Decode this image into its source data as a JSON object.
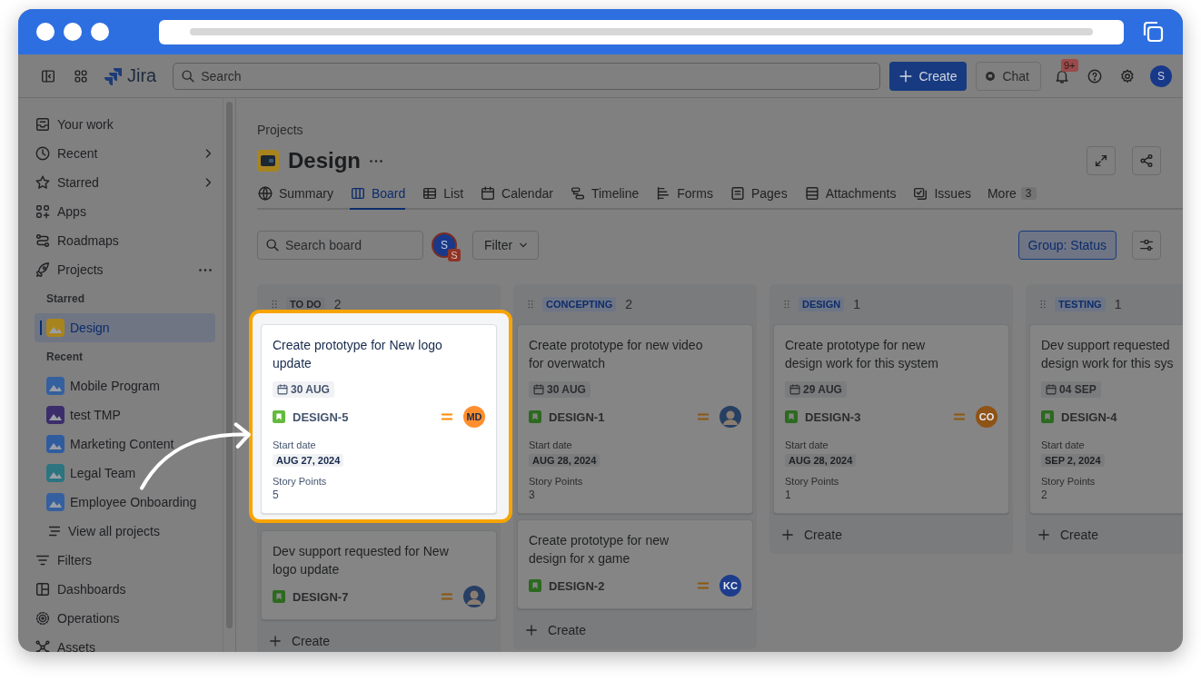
{
  "topbar": {
    "product": "Jira",
    "search": {
      "placeholder": "Search"
    },
    "create": "Create",
    "chat": "Chat",
    "notifications": "9+",
    "avatar": "S"
  },
  "sidebar": {
    "nav": [
      {
        "label": "Your work",
        "chevron": false
      },
      {
        "label": "Recent",
        "chevron": true
      },
      {
        "label": "Starred",
        "chevron": true
      },
      {
        "label": "Apps",
        "chevron": false
      },
      {
        "label": "Roadmaps",
        "chevron": false
      },
      {
        "label": "Projects",
        "chevron": false,
        "more_menu": true
      }
    ],
    "groups": [
      {
        "heading": "Starred",
        "projects": [
          {
            "name": "Design",
            "selected": true,
            "color": "#a8841f"
          }
        ]
      },
      {
        "heading": "Recent",
        "projects": [
          {
            "name": "Mobile Program",
            "selected": false,
            "color": "#35609f"
          },
          {
            "name": "test TMP",
            "selected": false,
            "color": "#3b2d6b"
          },
          {
            "name": "Marketing Content",
            "selected": false,
            "color": "#2f5c9f"
          },
          {
            "name": "Legal Team",
            "selected": false,
            "color": "#2b7480"
          },
          {
            "name": "Employee Onboarding",
            "selected": false,
            "color": "#35609f"
          }
        ]
      }
    ],
    "view_all": "View all projects",
    "bottom": [
      {
        "label": "Filters"
      },
      {
        "label": "Dashboards"
      },
      {
        "label": "Operations"
      },
      {
        "label": "Assets"
      }
    ]
  },
  "header": {
    "breadcrumb": "Projects",
    "title": "Design",
    "tabs": [
      {
        "label": "Summary",
        "selected": false
      },
      {
        "label": "Board",
        "selected": true
      },
      {
        "label": "List",
        "selected": false
      },
      {
        "label": "Calendar",
        "selected": false
      },
      {
        "label": "Timeline",
        "selected": false
      },
      {
        "label": "Forms",
        "selected": false
      },
      {
        "label": "Pages",
        "selected": false
      },
      {
        "label": "Attachments",
        "selected": false
      },
      {
        "label": "Issues",
        "selected": false
      }
    ],
    "more": {
      "label": "More",
      "count": "3"
    }
  },
  "toolbar": {
    "search": {
      "placeholder": "Search board"
    },
    "avatar": "S",
    "avatar_badge": "S",
    "filter": "Filter",
    "group": "Group: Status"
  },
  "columns": [
    {
      "name": "TO DO",
      "kind": "todo",
      "count": "2",
      "create": "Create",
      "cards": [
        {
          "title": "Create prototype for New logo\nupdate",
          "due": "30 AUG",
          "key": "DESIGN-5",
          "assignee": {
            "kind": "initials",
            "initials": "MD",
            "color": "#ff8f2e"
          },
          "start_label": "Start date",
          "start_date": "AUG 27, 2024",
          "points_label": "Story Points",
          "points": "5",
          "highlighted": true
        },
        {
          "title": "Dev support requested for New\nlogo update",
          "key": "DESIGN-7",
          "assignee": {
            "kind": "photo"
          },
          "highlighted": false
        }
      ]
    },
    {
      "name": "CONCEPTING",
      "kind": "active",
      "count": "2",
      "create": "Create",
      "cards": [
        {
          "title": "Create prototype for new video\nfor overwatch",
          "due": "30 AUG",
          "key": "DESIGN-1",
          "assignee": {
            "kind": "photo"
          },
          "start_label": "Start date",
          "start_date": "AUG 28, 2024",
          "points_label": "Story Points",
          "points": "3",
          "highlighted": false
        },
        {
          "title": "Create prototype for new\ndesign for x game",
          "key": "DESIGN-2",
          "assignee": {
            "kind": "initials",
            "initials": "KC",
            "color": "#1d3c8c"
          },
          "highlighted": false
        }
      ]
    },
    {
      "name": "DESIGN",
      "kind": "active",
      "count": "1",
      "create": "Create",
      "cards": [
        {
          "title": "Create prototype for new\ndesign work for this system",
          "due": "29 AUG",
          "key": "DESIGN-3",
          "assignee": {
            "kind": "initials",
            "initials": "CO",
            "color": "#8f5316"
          },
          "start_label": "Start date",
          "start_date": "AUG 28, 2024",
          "points_label": "Story Points",
          "points": "1",
          "highlighted": false
        }
      ]
    },
    {
      "name": "TESTING",
      "kind": "active",
      "count": "1",
      "create": "Create",
      "cards": [
        {
          "title": "Dev support requested\ndesign work for this sys",
          "due": "04 SEP",
          "key": "DESIGN-4",
          "start_label": "Start date",
          "start_date": "SEP 2, 2024",
          "points_label": "Story Points",
          "points": "2",
          "highlighted": false
        }
      ]
    }
  ]
}
